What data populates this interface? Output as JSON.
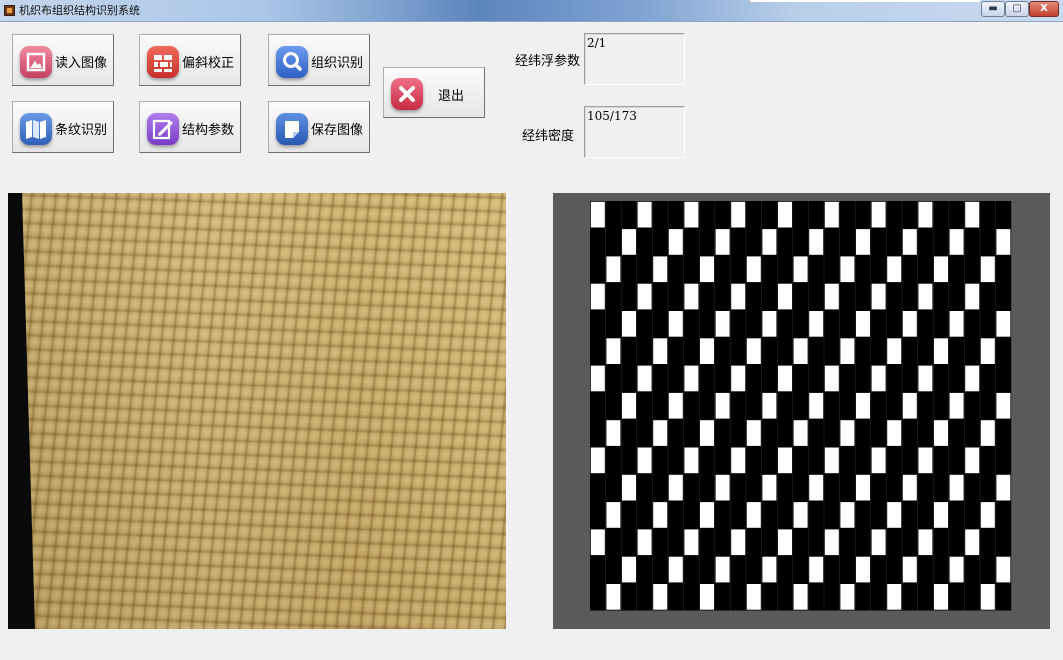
{
  "window": {
    "title": "机织布组织结构识别系统",
    "controls": {
      "minimize": "▬",
      "maximize": "▢",
      "close": "X"
    }
  },
  "toolbar": {
    "open_image": "读入图像",
    "skew_correct": "偏斜校正",
    "weave_recognize": "组织识别",
    "stripe_recognize": "条纹识别",
    "structure_params": "结构参数",
    "save_image": "保存图像",
    "exit": "退出"
  },
  "params": {
    "float_label": "经纬浮参数",
    "float_value": "2/1",
    "density_label": "经纬密度",
    "density_value": "105/173"
  },
  "colors": {
    "open_icon": "#d9546f",
    "skew_icon": "#e0473c",
    "weave_icon": "#3b6fd4",
    "stripe_icon": "#3a72c8",
    "params_icon": "#8b4fd0",
    "save_icon": "#2f6cc2",
    "exit_icon": "#d43a52",
    "weave_dark": "#000000",
    "weave_light": "#ffffff",
    "weave_background": "#5a5a5a"
  },
  "icons": {
    "open": "image-icon",
    "skew": "brick-icon",
    "weave": "magnifier-icon",
    "stripe": "map-icon",
    "params": "edit-icon",
    "save": "document-icon",
    "exit": "close-icon"
  },
  "weave_pattern": {
    "type": "3-end twill",
    "float": "2/1",
    "columns": 27,
    "rows": 15
  }
}
